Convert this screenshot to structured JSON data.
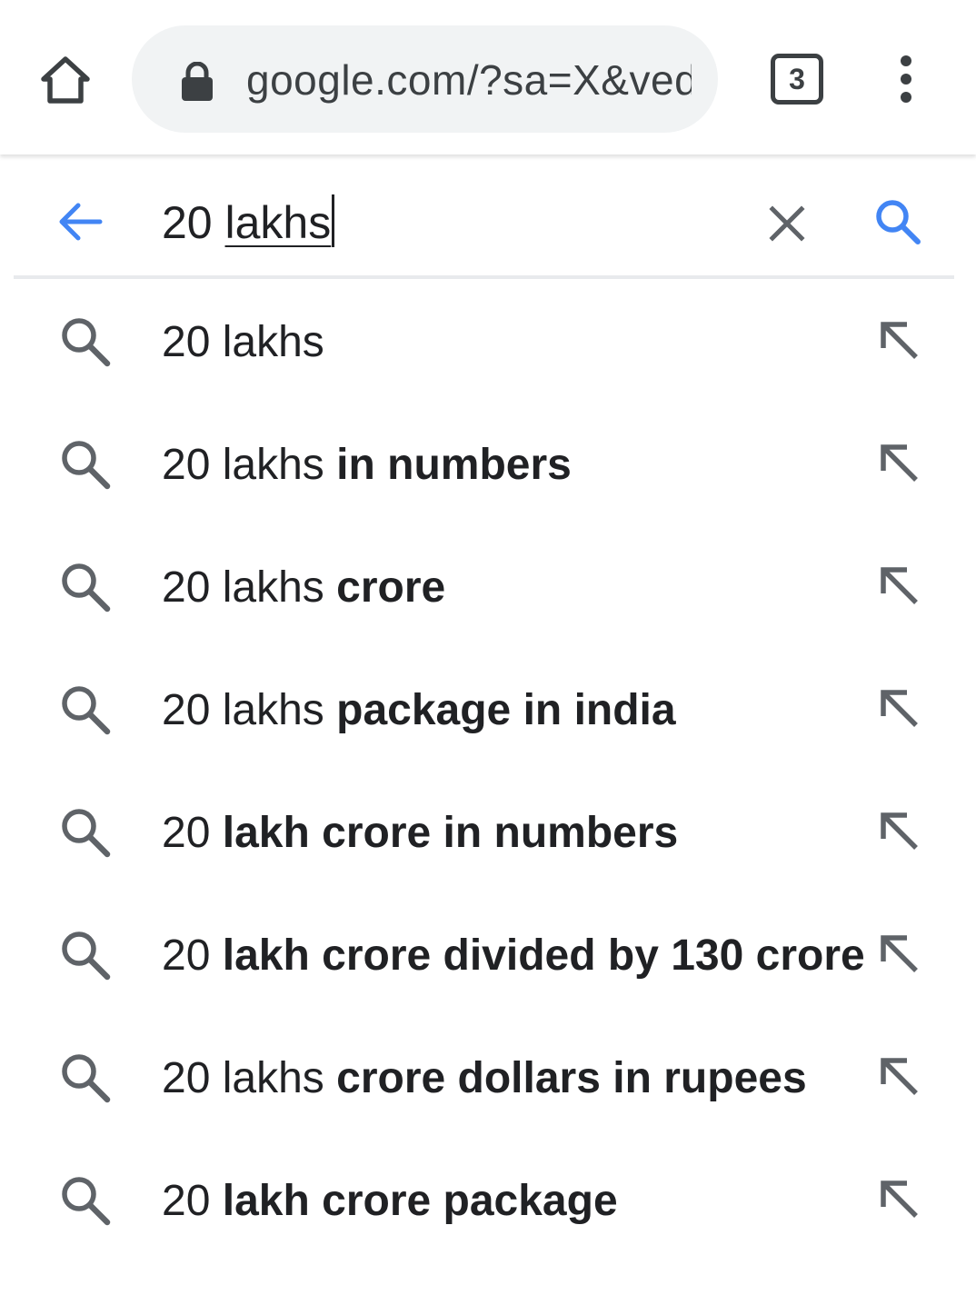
{
  "browser": {
    "url": "google.com/?sa=X&ved",
    "tab_count": "3",
    "icons": {
      "home": "home-icon",
      "lock": "lock-icon",
      "menu": "more-vert-icon"
    }
  },
  "search": {
    "query_prefix": "20 ",
    "query_composing": "lakhs",
    "icons": {
      "back": "arrow-back-icon",
      "clear": "close-icon",
      "submit": "search-icon"
    },
    "accent_color": "#4285f4"
  },
  "suggestions": [
    {
      "plain": "20 lakhs",
      "bold": ""
    },
    {
      "plain": "20 lakhs ",
      "bold": "in numbers"
    },
    {
      "plain": "20 lakhs ",
      "bold": "crore"
    },
    {
      "plain": "20 lakhs ",
      "bold": "package in india"
    },
    {
      "plain": "20 ",
      "bold": "lakh crore in numbers"
    },
    {
      "plain": "20 ",
      "bold": "lakh crore divided by 130 crore"
    },
    {
      "plain": "20 lakhs ",
      "bold": "crore dollars in rupees"
    },
    {
      "plain": "20 ",
      "bold": "lakh crore package"
    }
  ],
  "suggestion_icons": {
    "leading": "search-icon",
    "trailing": "arrow-up-left-icon"
  }
}
